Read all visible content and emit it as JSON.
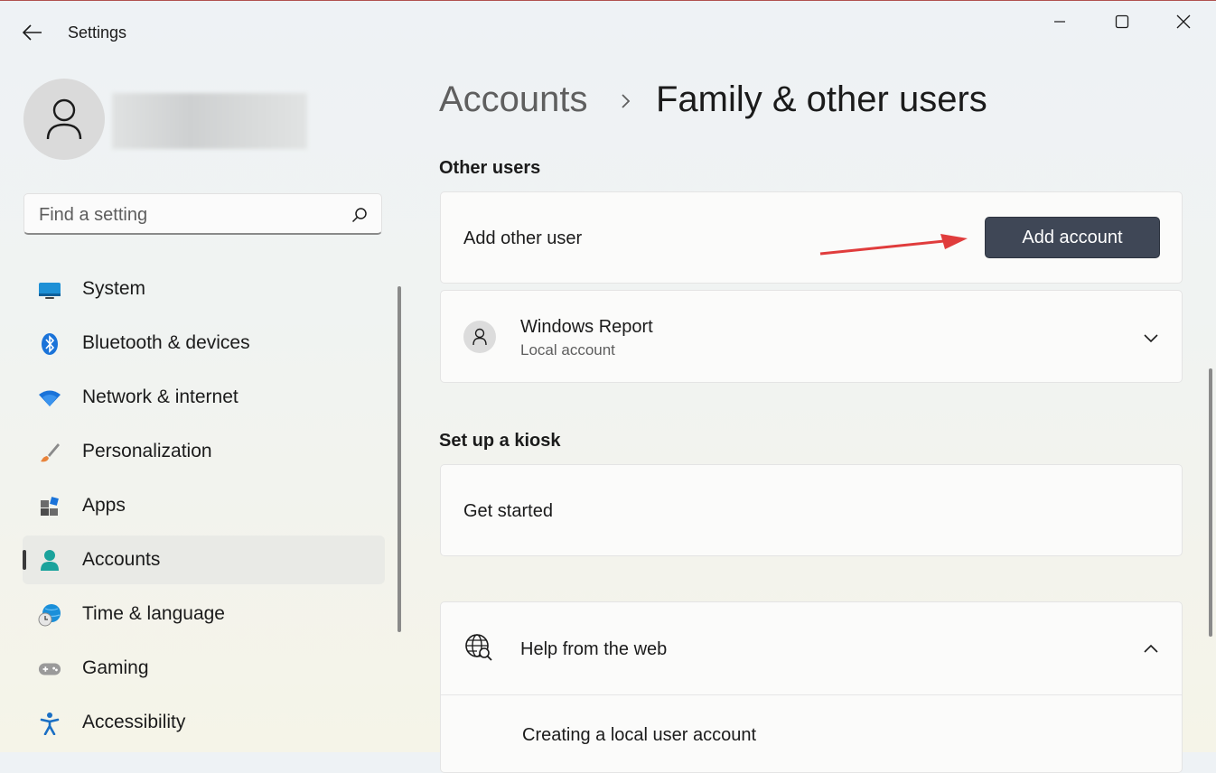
{
  "window": {
    "title": "Settings",
    "controls": [
      "minimize",
      "maximize",
      "close"
    ]
  },
  "search": {
    "placeholder": "Find a setting",
    "value": ""
  },
  "sidebar": {
    "items": [
      {
        "label": "System",
        "icon": "system-icon",
        "active": false
      },
      {
        "label": "Bluetooth & devices",
        "icon": "bluetooth-icon",
        "active": false
      },
      {
        "label": "Network & internet",
        "icon": "wifi-icon",
        "active": false
      },
      {
        "label": "Personalization",
        "icon": "brush-icon",
        "active": false
      },
      {
        "label": "Apps",
        "icon": "apps-icon",
        "active": false
      },
      {
        "label": "Accounts",
        "icon": "accounts-icon",
        "active": true
      },
      {
        "label": "Time & language",
        "icon": "globe-clock-icon",
        "active": false
      },
      {
        "label": "Gaming",
        "icon": "gamepad-icon",
        "active": false
      },
      {
        "label": "Accessibility",
        "icon": "accessibility-icon",
        "active": false
      }
    ]
  },
  "breadcrumb": {
    "parent": "Accounts",
    "current": "Family & other users"
  },
  "other_users": {
    "title": "Other users",
    "add_label": "Add other user",
    "add_button": "Add account",
    "user": {
      "name": "Windows Report",
      "type": "Local account"
    }
  },
  "kiosk": {
    "title": "Set up a kiosk",
    "action": "Get started"
  },
  "help": {
    "title": "Help from the web",
    "links": [
      "Creating a local user account"
    ]
  },
  "colors": {
    "accent_button": "#3f4756",
    "annotation_arrow": "#e03c3c"
  }
}
